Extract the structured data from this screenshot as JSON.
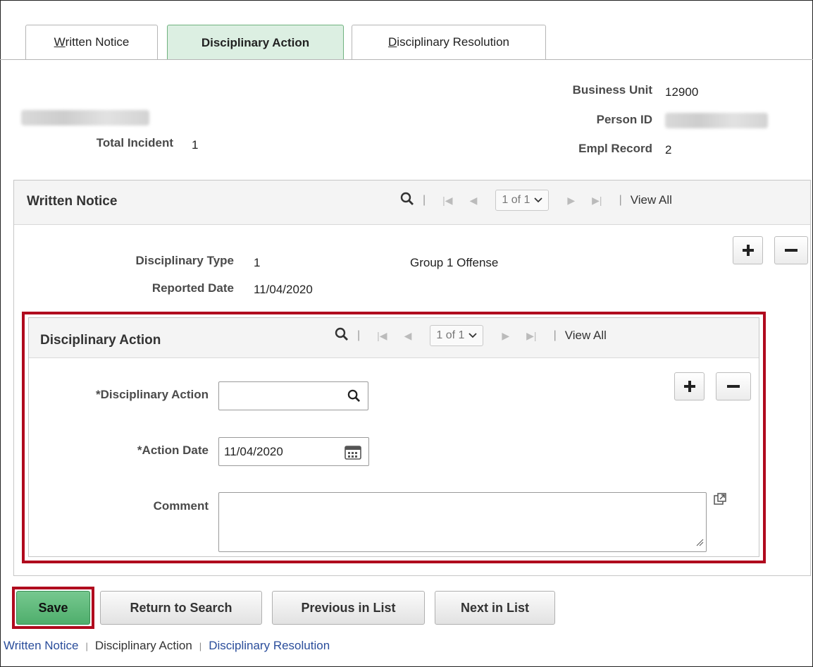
{
  "tabs": [
    {
      "label": "Written Notice",
      "underline": "W",
      "rest": "ritten Notice",
      "active": false
    },
    {
      "label": "Disciplinary Action",
      "active": true
    },
    {
      "label": "Disciplinary Resolution",
      "underline": "D",
      "rest": "isciplinary Resolution",
      "active": false
    }
  ],
  "header": {
    "total_incident_label": "Total Incident",
    "total_incident_value": "1",
    "business_unit_label": "Business Unit",
    "business_unit_value": "12900",
    "person_id_label": "Person ID",
    "empl_record_label": "Empl Record",
    "empl_record_value": "2"
  },
  "written_notice": {
    "title": "Written Notice",
    "pager": "1 of 1",
    "view_all": "View All",
    "disciplinary_type_label": "Disciplinary Type",
    "disciplinary_type_value": "1",
    "disciplinary_type_desc": "Group 1 Offense",
    "reported_date_label": "Reported Date",
    "reported_date_value": "11/04/2020"
  },
  "disciplinary_action": {
    "title": "Disciplinary Action",
    "pager": "1 of 1",
    "view_all": "View All",
    "action_label": "*Disciplinary Action",
    "action_value": "",
    "action_date_label": "*Action Date",
    "action_date_value": "11/04/2020",
    "comment_label": "Comment",
    "comment_value": ""
  },
  "buttons": {
    "save": "Save",
    "return_to_search": "Return to Search",
    "previous_in_list": "Previous in List",
    "next_in_list": "Next in List"
  },
  "footer": {
    "written_notice": "Written Notice",
    "disciplinary_action": "Disciplinary Action",
    "disciplinary_resolution": "Disciplinary Resolution"
  },
  "colors": {
    "active_tab": "#dcefe2",
    "highlight": "#b00a1e",
    "save_button": "#5cb87a",
    "link": "#2a4d9b"
  }
}
